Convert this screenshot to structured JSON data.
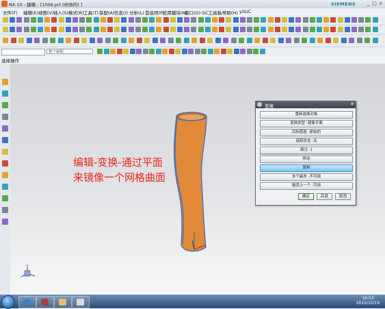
{
  "window": {
    "title": "NX 10 - 建模 - [1006.prt (修改的) ]",
    "brand": "SIEMENS",
    "controls": [
      "_",
      "□",
      "×"
    ]
  },
  "menu": [
    "文件(F)",
    "编辑(E)",
    "视图(V)",
    "插入(S)",
    "格式(R)",
    "工具(T)",
    "装配(A)",
    "信息(I)",
    "分析(L)",
    "首选项(P)",
    "应用模块(N)",
    "窗口(O)",
    "GC工具箱",
    "帮助(H)",
    "ySUC"
  ],
  "selection_bar": {
    "filter_placeholder": "",
    "scope_value": "整个装配"
  },
  "cue_line": "选择操作",
  "caption": {
    "line1": "编辑-变换-通过平面",
    "line2": "来镜像一个网格曲面"
  },
  "dialog": {
    "title": "变换",
    "buttons": [
      {
        "label": "重新选择对象",
        "selected": false
      },
      {
        "label": "变换类型 -镜像平面",
        "selected": false
      },
      {
        "label": "目标图层 -原始的",
        "selected": false
      },
      {
        "label": "追踪状态 -关",
        "selected": false
      },
      {
        "label": "细分 -1",
        "selected": false
      },
      {
        "label": "移动",
        "selected": false
      },
      {
        "label": "复制",
        "selected": true
      },
      {
        "label": "多个副本 -不可用",
        "selected": false
      },
      {
        "label": "撤消上一个 -可用",
        "selected": false
      }
    ],
    "footer": {
      "ok": "确定",
      "back": "后退",
      "cancel": "取消"
    }
  },
  "taskbar": {
    "time": "16:53",
    "date": "2015/10/19"
  },
  "colors": {
    "part": "#e08a3a",
    "part_edge": "#4d6fa8",
    "caption": "#e8271d",
    "selected_button": "#7ec3ef"
  }
}
